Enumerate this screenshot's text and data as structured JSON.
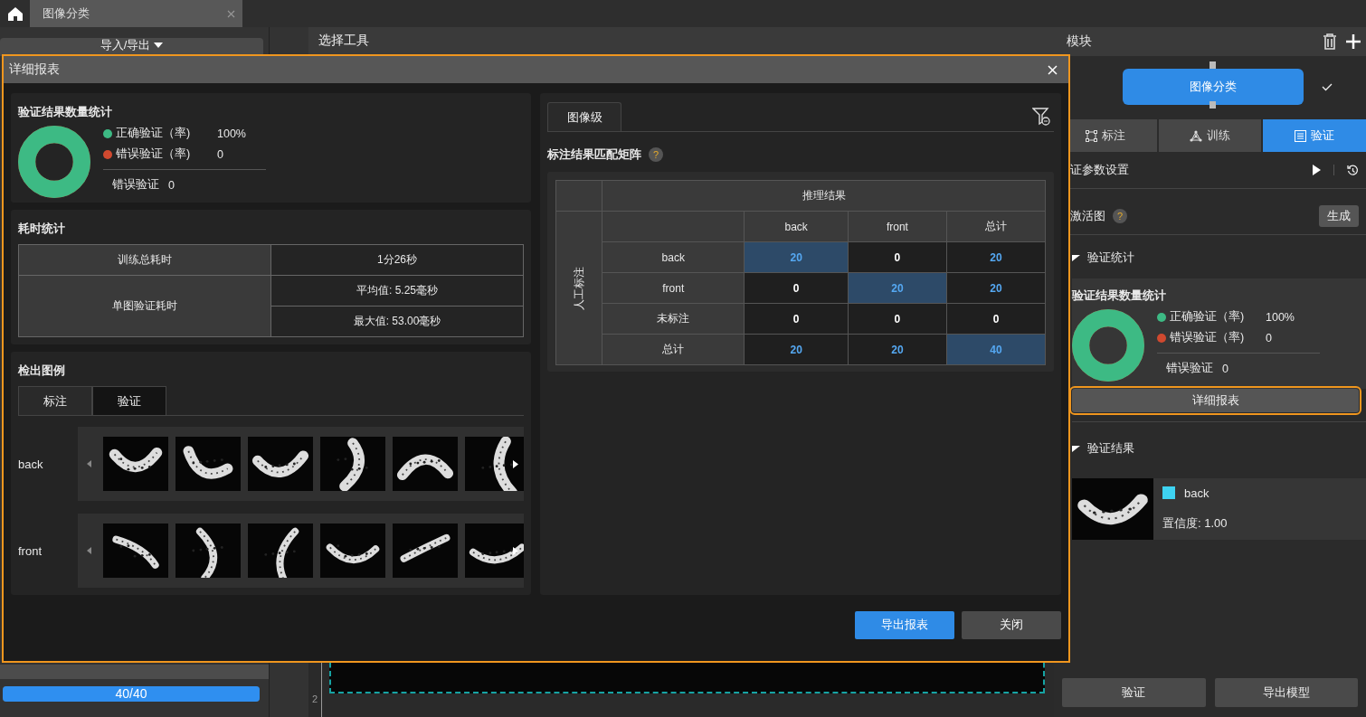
{
  "top_tabs": [
    {
      "label": "图像分类",
      "selected": true,
      "closable": true
    }
  ],
  "left_panel": {
    "import_export": "导入/导出",
    "progress": {
      "level": 1,
      "reading": "40/40"
    }
  },
  "center": {
    "title": "选择工具",
    "ruler_labels": [
      "2"
    ]
  },
  "right_panel": {
    "title": "模块",
    "node": {
      "label": "图像分类",
      "checked": true
    },
    "tabs": [
      {
        "label": "标注",
        "kind": "annotate",
        "selected": false
      },
      {
        "label": "训练",
        "kind": "train",
        "selected": false
      },
      {
        "label": "验证",
        "kind": "verify",
        "selected": true
      }
    ],
    "params_label": "证参数设置",
    "activation_label": "激活图",
    "activation_help": "?",
    "generate_button": "生成",
    "stats_section": {
      "title": "验证统计",
      "expanded": true
    },
    "stats": {
      "title": "验证结果数量统计",
      "legend": [
        {
          "label": "正确验证（率)",
          "value": "100%",
          "color": "#3dba84"
        },
        {
          "label": "错误验证（率)",
          "value": "0",
          "color": "#d0492f"
        }
      ],
      "error_label": "错误验证",
      "error_value": "0"
    },
    "details_button": {
      "label": "详细报表",
      "highlighted": true
    },
    "results_section": {
      "title": "验证结果",
      "expanded": true
    },
    "result": {
      "label": "back",
      "color": "#3ed3f2",
      "confidence": "置信度: 1.00"
    },
    "buttons": [
      "验证",
      "导出模型"
    ]
  },
  "dialog": {
    "title": "详细报表",
    "stats": {
      "title": "验证结果数量统计",
      "legend": [
        {
          "label": "正确验证（率)",
          "value": "100%",
          "color": "#3dba84"
        },
        {
          "label": "错误验证（率)",
          "value": "0",
          "color": "#d0492f"
        }
      ],
      "error_label": "错误验证",
      "error_value": "0"
    },
    "timing": {
      "title": "耗时统计",
      "rows": [
        {
          "label": "训练总耗时",
          "values": [
            "1分26秒"
          ]
        },
        {
          "label": "单图验证耗时",
          "values": [
            "平均值: 5.25毫秒",
            "最大值: 53.00毫秒"
          ]
        }
      ]
    },
    "examples": {
      "title": "检出图例",
      "tabs": [
        {
          "label": "标注",
          "selected": true
        },
        {
          "label": "验证",
          "selected": false
        }
      ],
      "rows": [
        {
          "label": "back"
        },
        {
          "label": "front"
        }
      ]
    },
    "matrix_tabs": [
      {
        "label": "图像级",
        "selected": true
      }
    ],
    "matrix": {
      "title": "标注结果匹配矩阵",
      "help": "?",
      "column_group": "推理结果",
      "row_group": "人工标注",
      "columns": [
        "back",
        "front",
        "总计"
      ],
      "rows": [
        {
          "label": "back",
          "cells": [
            {
              "value": "20",
              "highlighted": true,
              "accent": true
            },
            {
              "value": "0",
              "highlighted": false,
              "accent": false
            },
            {
              "value": "20",
              "highlighted": false,
              "accent": true
            }
          ]
        },
        {
          "label": "front",
          "cells": [
            {
              "value": "0",
              "highlighted": false,
              "accent": false
            },
            {
              "value": "20",
              "highlighted": true,
              "accent": true
            },
            {
              "value": "20",
              "highlighted": false,
              "accent": true
            }
          ]
        },
        {
          "label": "未标注",
          "cells": [
            {
              "value": "0",
              "highlighted": false,
              "accent": false
            },
            {
              "value": "0",
              "highlighted": false,
              "accent": false
            },
            {
              "value": "0",
              "highlighted": false,
              "accent": false
            }
          ]
        },
        {
          "label": "总计",
          "cells": [
            {
              "value": "20",
              "highlighted": false,
              "accent": true
            },
            {
              "value": "20",
              "highlighted": false,
              "accent": true
            },
            {
              "value": "40",
              "highlighted": true,
              "accent": true
            }
          ]
        }
      ]
    },
    "buttons": [
      {
        "label": "导出报表",
        "kind": "primary"
      },
      {
        "label": "关闭",
        "kind": "secondary"
      }
    ]
  }
}
